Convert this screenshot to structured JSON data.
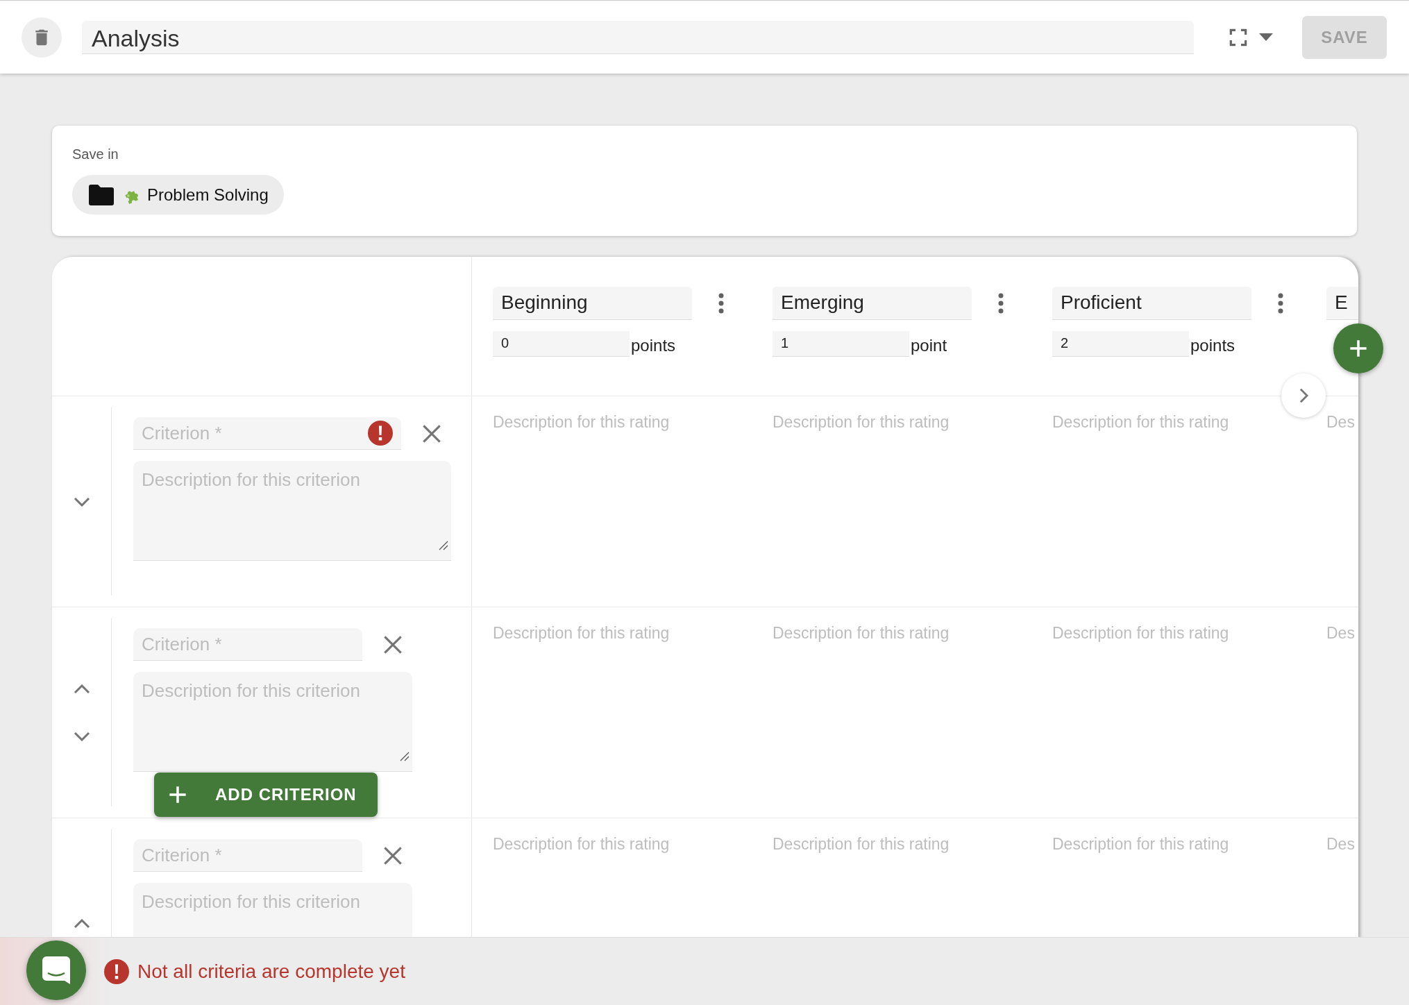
{
  "toolbar": {
    "title": "Analysis",
    "save_button": "SAVE",
    "save_disabled": true
  },
  "save_in": {
    "label": "Save in",
    "folder": "Problem Solving"
  },
  "ratings": [
    {
      "name": "Beginning",
      "points": "0",
      "unit": "points"
    },
    {
      "name": "Emerging",
      "points": "1",
      "unit": "point"
    },
    {
      "name": "Proficient",
      "points": "2",
      "unit": "points"
    },
    {
      "name": "E"
    }
  ],
  "criteria": [
    {
      "placeholder": "Criterion *",
      "description_placeholder": "Description for this criterion",
      "error": true,
      "move_up": false,
      "move_down": true,
      "ratings": [
        "Description for this rating",
        "Description for this rating",
        "Description for this rating",
        "Des"
      ]
    },
    {
      "placeholder": "Criterion *",
      "description_placeholder": "Description for this criterion",
      "error": false,
      "move_up": true,
      "move_down": true,
      "ratings": [
        "Description for this rating",
        "Description for this rating",
        "Description for this rating",
        "Des"
      ]
    },
    {
      "placeholder": "Criterion *",
      "description_placeholder": "Description for this criterion",
      "error": false,
      "move_up": true,
      "move_down": false,
      "ratings": [
        "Description for this rating",
        "Description for this rating",
        "Description for this rating",
        "Des"
      ]
    }
  ],
  "add_criterion": "ADD CRITERION",
  "status": {
    "error": true,
    "message": "Not all criteria are complete yet"
  }
}
